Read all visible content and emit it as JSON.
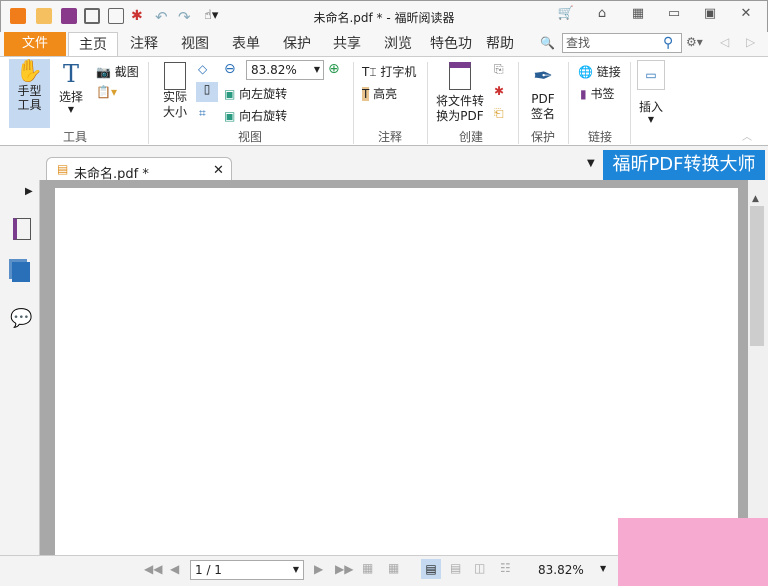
{
  "window": {
    "title": "未命名.pdf * - 福昕阅读器"
  },
  "menu": {
    "file": "文件",
    "tabs": [
      "主页",
      "注释",
      "视图",
      "表单",
      "保护",
      "共享",
      "浏览",
      "特色功",
      "帮助"
    ],
    "search_placeholder": "查找"
  },
  "ribbon": {
    "tools": {
      "hand": "手型\n工具",
      "hand1": "手型",
      "hand2": "工具",
      "select": "选择",
      "screenshot": "截图",
      "group": "工具"
    },
    "view": {
      "actual1": "实际",
      "actual2": "大小",
      "zoom": "83.82%",
      "rotate_left": "向左旋转",
      "rotate_right": "向右旋转",
      "group": "视图"
    },
    "comment": {
      "typewriter": "打字机",
      "highlight": "高亮",
      "group": "注释"
    },
    "create": {
      "convert1": "将文件转",
      "convert2": "换为PDF",
      "group": "创建"
    },
    "protect": {
      "sign1": "PDF",
      "sign2": "签名",
      "group": "保护"
    },
    "links": {
      "link": "链接",
      "bookmark": "书签",
      "group": "链接"
    },
    "insert": {
      "label": "插入"
    }
  },
  "document_tab": {
    "name": "未命名.pdf *"
  },
  "brand_banner": "福昕PDF转换大师",
  "status": {
    "page": "1 / 1",
    "zoom": "83.82%"
  },
  "colors": {
    "file_tab": "#f08a18",
    "brand": "#1e86d8",
    "accent_pink": "#f7aad0"
  }
}
